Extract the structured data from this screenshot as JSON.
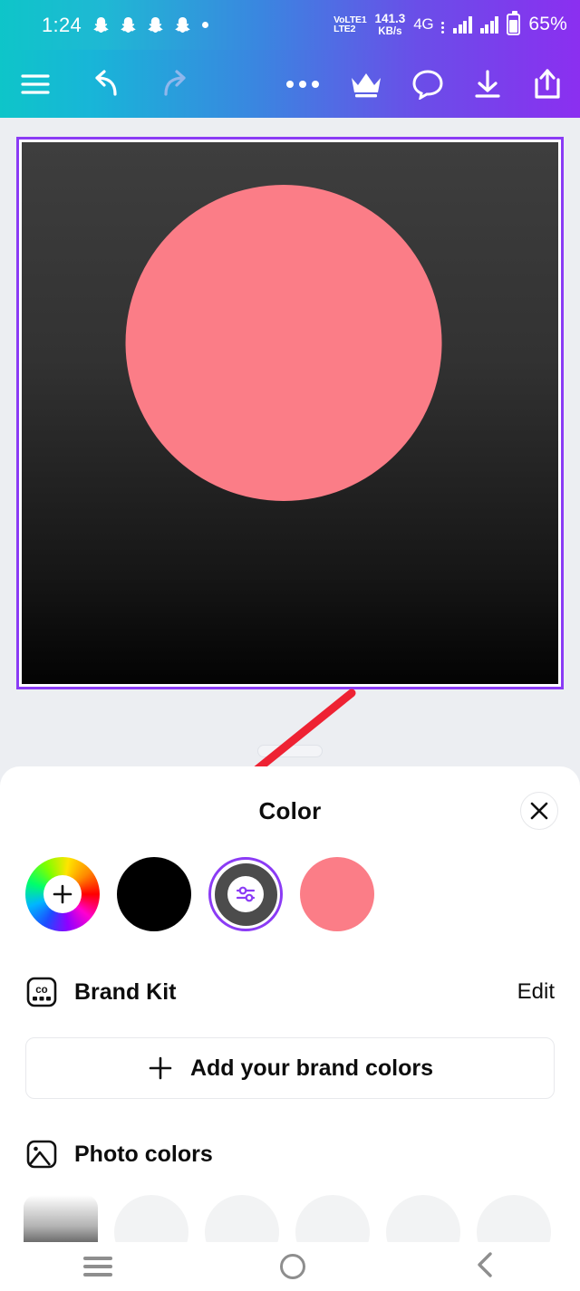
{
  "statusbar": {
    "time": "1:24",
    "notification_icons": [
      "snapchat-ghost",
      "snapchat-ghost",
      "snapchat-ghost",
      "snapchat-ghost",
      "dot"
    ],
    "volte_line1": "VoLTE1",
    "volte_line2": "LTE2",
    "netspeed_value": "141.3",
    "netspeed_unit": "KB/s",
    "network_type": "4G",
    "battery_percent": "65%"
  },
  "toolbar": {
    "menu_label": "Menu",
    "undo_label": "Undo",
    "redo_label": "Redo",
    "more_label": "More",
    "pro_label": "Pro",
    "comment_label": "Comments",
    "download_label": "Download",
    "share_label": "Share"
  },
  "canvas": {
    "background_gradient_top": "#3e3e3e",
    "background_gradient_bottom": "#030303",
    "shape_color": "#fb7d87",
    "selection_border_color": "#8b3bf5"
  },
  "annotation": {
    "arrow_color": "#ee2233"
  },
  "sheet": {
    "title": "Color",
    "close_label": "Close",
    "swatches": [
      {
        "name": "color-picker-wheel",
        "label": "Custom color",
        "color": "rainbow",
        "selected": false
      },
      {
        "name": "black",
        "label": "Black",
        "color": "#000000",
        "selected": false
      },
      {
        "name": "gradient-editor",
        "label": "Gradient",
        "color": "#4c4c4c",
        "selected": true
      },
      {
        "name": "salmon-pink",
        "label": "Salmon pink",
        "color": "#fb7d87",
        "selected": false
      }
    ],
    "brand_kit": {
      "label": "Brand Kit",
      "action": "Edit"
    },
    "add_brand_colors": {
      "label": "Add your brand colors"
    },
    "photo_colors": {
      "label": "Photo colors",
      "swatches": [
        {
          "name": "photo-color-gradient",
          "color": "white-to-black-gradient"
        },
        {
          "name": "photo-color-placeholder",
          "color": "#f2f3f4"
        },
        {
          "name": "photo-color-placeholder",
          "color": "#f2f3f4"
        },
        {
          "name": "photo-color-placeholder",
          "color": "#f2f3f4"
        },
        {
          "name": "photo-color-placeholder",
          "color": "#f2f3f4"
        },
        {
          "name": "photo-color-placeholder",
          "color": "#f2f3f4"
        }
      ]
    }
  },
  "navbar": {
    "recents_label": "Recents",
    "home_label": "Home",
    "back_label": "Back"
  }
}
